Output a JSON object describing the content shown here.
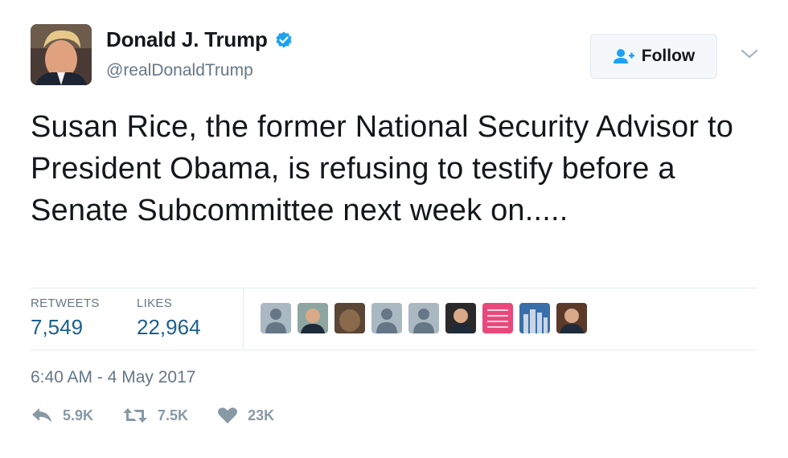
{
  "tweet": {
    "display_name": "Donald J. Trump",
    "handle": "@realDonaldTrump",
    "text": "Susan Rice, the former National Security Advisor to President Obama, is refusing to testify before a Senate Subcommittee next week on.....",
    "timestamp": "6:40 AM - 4 May 2017"
  },
  "follow": {
    "label": "Follow"
  },
  "stats": {
    "retweets_label": "RETWEETS",
    "retweets_value": "7,549",
    "likes_label": "LIKES",
    "likes_value": "22,964"
  },
  "likers": [
    {
      "icon": "default-avatar-icon",
      "color": "#aab8c2"
    },
    {
      "icon": "photo-avatar",
      "color": "#8fa6a0"
    },
    {
      "icon": "dog-avatar",
      "color": "#5a4636"
    },
    {
      "icon": "default-avatar-icon",
      "color": "#aab8c2"
    },
    {
      "icon": "default-avatar-icon",
      "color": "#aab8c2"
    },
    {
      "icon": "photo-avatar",
      "color": "#2a2a2a"
    },
    {
      "icon": "pink-text-avatar",
      "color": "#e8497c"
    },
    {
      "icon": "city-avatar",
      "color": "#3a6ea8"
    },
    {
      "icon": "photo-avatar",
      "color": "#5b3a2a"
    }
  ],
  "actions": {
    "reply_count": "5.9K",
    "retweet_count": "7.5K",
    "like_count": "23K"
  },
  "colors": {
    "verified": "#1da1f2",
    "link_count": "#1b5f8f",
    "muted": "#657786",
    "action_gray": "#8899a6"
  }
}
